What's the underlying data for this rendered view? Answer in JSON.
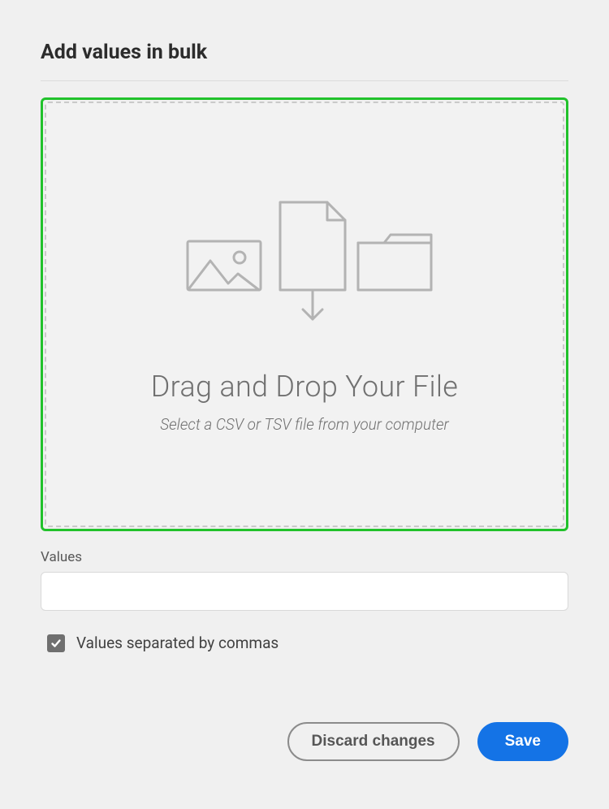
{
  "header": {
    "title": "Add values in bulk"
  },
  "dropzone": {
    "title": "Drag and Drop Your File",
    "subtitle": "Select a CSV or TSV file from your computer"
  },
  "values_field": {
    "label": "Values",
    "value": ""
  },
  "checkbox": {
    "label": "Values separated by commas",
    "checked": true
  },
  "buttons": {
    "discard": "Discard changes",
    "save": "Save"
  }
}
